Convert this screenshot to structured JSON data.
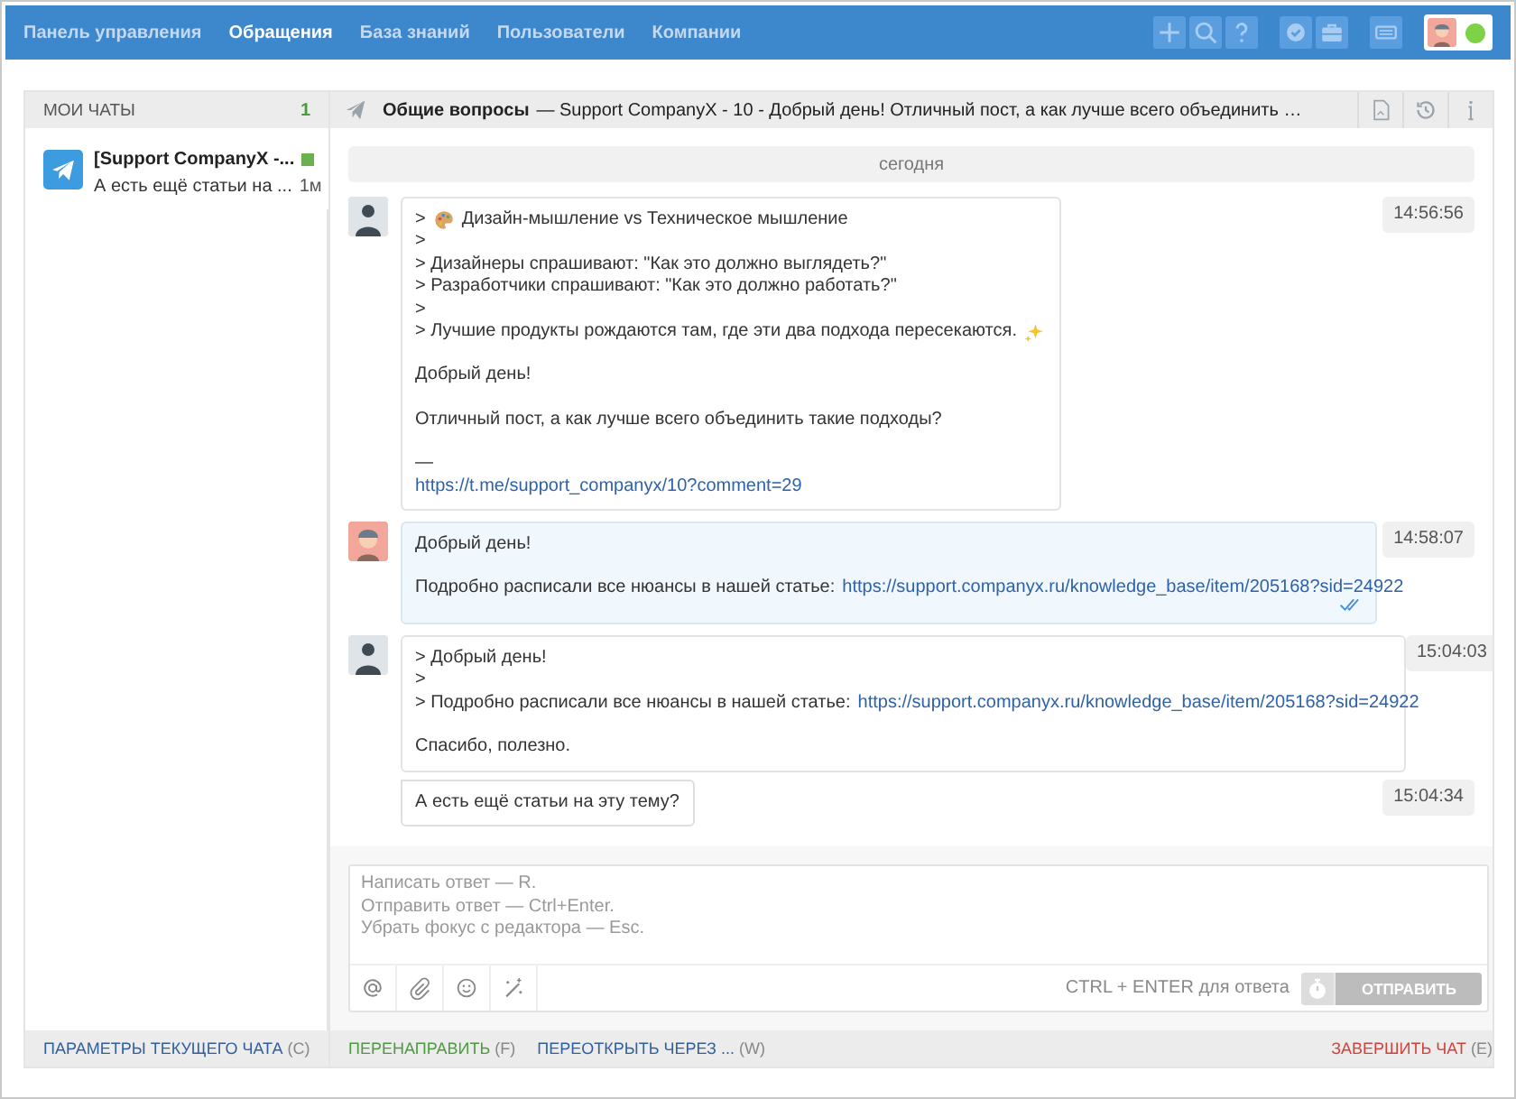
{
  "nav": {
    "items": [
      {
        "label": "Панель управления",
        "selected": false
      },
      {
        "label": "Обращения",
        "selected": true
      },
      {
        "label": "База знаний",
        "selected": false
      },
      {
        "label": "Пользователи",
        "selected": false
      },
      {
        "label": "Компании",
        "selected": false
      }
    ],
    "user": {
      "online": true
    }
  },
  "sidebar": {
    "title": "МОИ ЧАТЫ",
    "count": "1",
    "chats": [
      {
        "title": "[Support CompanyX -...",
        "preview": "А есть ещё статьи на ...",
        "time": "1м",
        "unread": true
      }
    ],
    "footer": {
      "label": "ПАРАМЕТРЫ ТЕКУЩЕГО ЧАТА",
      "shortcut": "(C)"
    }
  },
  "chat": {
    "topic": "Общие вопросы",
    "subject": "— Support CompanyX - 10 - Добрый день! Отличный пост, а как лучше всего объединить …",
    "date_divider": "сегодня",
    "messages": [
      {
        "kind": "client",
        "time": "14:56:56",
        "paragraphs": [
          [
            {
              "kind": "palette",
              "prefix": ">",
              "text": "Дизайн-мышление vs Техническое мышление"
            },
            {
              "text": ">"
            },
            {
              "text": "> Дизайнеры спрашивают: \"Как это должно выглядеть?\""
            },
            {
              "text": "> Разработчики спрашивают: \"Как это должно работать?\""
            },
            {
              "text": ">"
            },
            {
              "kind": "sparkle",
              "text": "> Лучшие продукты рождаются там, где эти два подхода пересекаются."
            }
          ],
          [
            {
              "text": "Добрый день!"
            }
          ],
          [
            {
              "text": "Отличный пост, а как лучше всего объединить такие подходы?"
            }
          ],
          [
            {
              "text": "—"
            },
            {
              "link": "https://t.me/support_companyx/10?comment=29"
            }
          ]
        ]
      },
      {
        "kind": "operator",
        "time": "14:58:07",
        "read": true,
        "paragraphs": [
          [
            {
              "text": "Добрый день!"
            }
          ],
          [
            {
              "text": "Подробно расписали все нюансы в нашей статье:",
              "link": "https://support.companyx.ru/knowledge_base/item/205168?sid=24922"
            }
          ]
        ]
      },
      {
        "kind": "client",
        "time": "15:04:03",
        "paragraphs": [
          [
            {
              "text": "> Добрый день!"
            },
            {
              "text": ">"
            },
            {
              "text": "> Подробно расписали все нюансы в нашей статье:",
              "link": "https://support.companyx.ru/knowledge_base/item/205168?sid=24922"
            }
          ],
          [
            {
              "text": "Спасибо, полезно."
            }
          ]
        ]
      },
      {
        "kind": "client",
        "time": "15:04:34",
        "continued": true,
        "paragraphs": [
          [
            {
              "text": "А есть ещё статьи на эту тему?"
            }
          ]
        ]
      }
    ],
    "composer": {
      "placeholder": "Написать ответ — R.\nОтправить ответ — Ctrl+Enter.\nУбрать фокус с редактора — Esc.",
      "hint": "CTRL + ENTER для ответа",
      "send": {
        "label": "ОТПРАВИТЬ",
        "disabled": true
      }
    },
    "actions": [
      {
        "kind": "forward",
        "label": "ПЕРЕНАПРАВИТЬ",
        "shortcut": "(F)"
      },
      {
        "kind": "reopen",
        "label": "ПЕРЕОТКРЫТЬ ЧЕРЕЗ ...",
        "shortcut": "(W)"
      },
      {
        "kind": "close",
        "label": "ЗАВЕРШИТЬ ЧАТ",
        "shortcut": "(E)"
      }
    ]
  }
}
